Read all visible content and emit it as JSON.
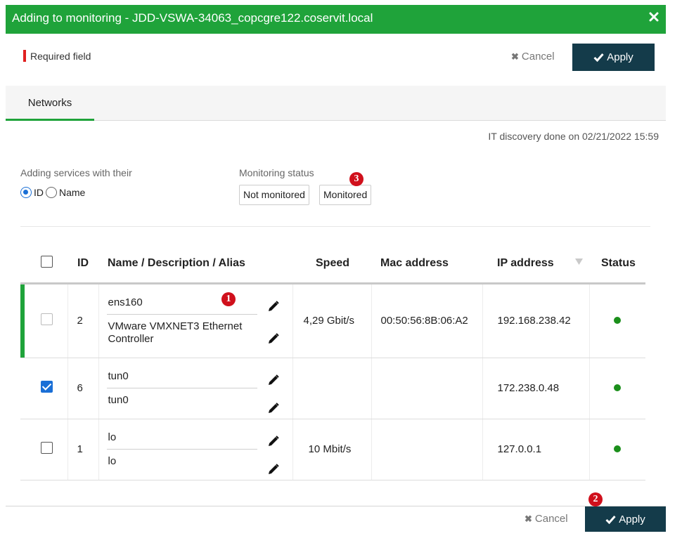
{
  "window": {
    "title": "Adding to monitoring - JDD-VSWA-34063_copcgre122.coservit.local",
    "close_icon": "close-icon"
  },
  "header": {
    "required_label": "Required field",
    "cancel_label": "Cancel",
    "apply_label": "Apply"
  },
  "tabs": [
    {
      "label": "Networks",
      "active": true
    }
  ],
  "discovery_text": "IT discovery done on 02/21/2022 15:59",
  "adding_services": {
    "label": "Adding services with their",
    "options": [
      "ID",
      "Name"
    ],
    "selected": "ID"
  },
  "monitoring_status": {
    "label": "Monitoring status",
    "buttons": [
      "Not monitored",
      "Monitored"
    ]
  },
  "badges": [
    "1",
    "2",
    "3"
  ],
  "table": {
    "headers": {
      "id": "ID",
      "name": "Name / Description / Alias",
      "speed": "Speed",
      "mac": "Mac address",
      "ip": "IP address",
      "status": "Status"
    },
    "rows": [
      {
        "checked": false,
        "disabled": true,
        "id": "2",
        "name": "ens160",
        "description": "VMware VMXNET3 Ethernet Controller",
        "speed": "4,29 Gbit/s",
        "mac": "00:50:56:8B:06:A2",
        "ip": "192.168.238.42",
        "status_color": "#1b8f1b"
      },
      {
        "checked": true,
        "disabled": false,
        "id": "6",
        "name": "tun0",
        "description": "tun0",
        "speed": "",
        "mac": "",
        "ip": "172.238.0.48",
        "status_color": "#1b8f1b"
      },
      {
        "checked": false,
        "disabled": false,
        "id": "1",
        "name": "lo",
        "description": "lo",
        "speed": "10 Mbit/s",
        "mac": "",
        "ip": "127.0.0.1",
        "status_color": "#1b8f1b"
      }
    ]
  },
  "footer": {
    "cancel_label": "Cancel",
    "apply_label": "Apply"
  },
  "colors": {
    "title_bar": "#1fa33a",
    "apply_button": "#143b4a",
    "required_marker": "#e02020",
    "badge": "#d0101c",
    "checkbox_checked": "#1a6fd6",
    "status_ok": "#1b8f1b"
  }
}
